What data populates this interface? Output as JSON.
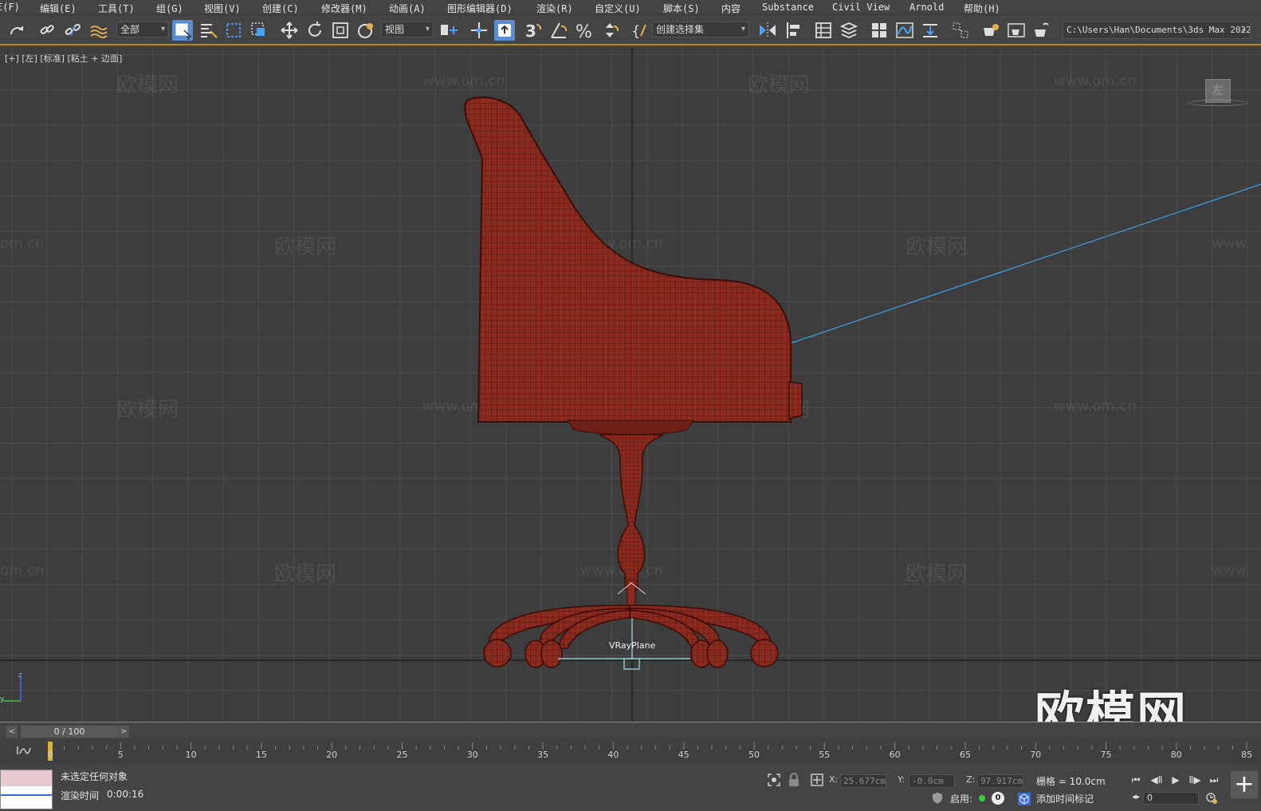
{
  "menubar": {
    "items": [
      "Ξ(F)",
      "编辑(E)",
      "工具(T)",
      "组(G)",
      "视图(V)",
      "创建(C)",
      "修改器(M)",
      "动画(A)",
      "图形编辑器(D)",
      "渲染(R)",
      "自定义(U)",
      "脚本(S)",
      "内容",
      "Substance",
      "Civil View",
      "Arnold",
      "帮助(H)"
    ]
  },
  "toolbar": {
    "selection_filter": "全部",
    "reference_coord": "视图",
    "named_selection": "创建选择集",
    "project_path": "C:\\Users\\Han\\Documents\\3ds Max 2022"
  },
  "viewport": {
    "label": "[+] [左] [标准] [粘土 + 边面]",
    "viewcube_face": "左",
    "object_label": "VRayPlane",
    "watermark_cn": "欧模网",
    "watermark_url": "www.om.cn",
    "watermark_url_part": "om.cn",
    "watermark_url_left": "www.",
    "big_watermark": "欧模网",
    "axis_z": "z",
    "axis_y": "y"
  },
  "timeline": {
    "frame_display": "0 / 100",
    "ticks": [
      "0",
      "5",
      "10",
      "15",
      "20",
      "25",
      "30",
      "35",
      "40",
      "45",
      "50",
      "55",
      "60",
      "65",
      "70",
      "75",
      "80",
      "85"
    ]
  },
  "status": {
    "selection": "未选定任何对象",
    "render_time_label": "渲染时间",
    "render_time": "0:00:16",
    "x_label": "X:",
    "x_value": "25.677cm",
    "y_label": "Y:",
    "y_value": "-0.0cm",
    "z_label": "Z:",
    "z_value": "97.917cm",
    "grid": "栅格 = 10.0cm",
    "enable_label": "启用:",
    "enable_count": "0",
    "add_time_tag": "添加时间标记",
    "current_frame": "0"
  },
  "colors": {
    "model": "#8b2a1f",
    "model_wire": "#4a120c",
    "accent": "#b48a1e",
    "active_button": "#5b8bd0",
    "light_line": "#3aa0e8"
  }
}
